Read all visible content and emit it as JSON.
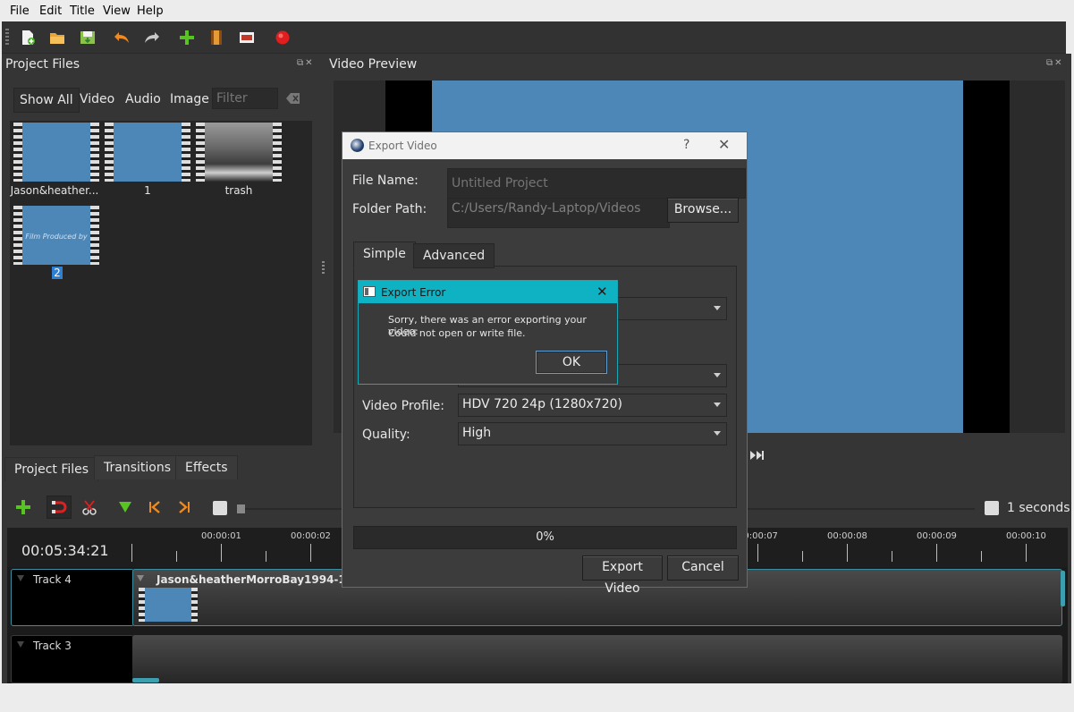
{
  "menu": [
    "File",
    "Edit",
    "Title",
    "View",
    "Help"
  ],
  "project_files": {
    "title": "Project Files",
    "filters": [
      "Show All",
      "Video",
      "Audio",
      "Image"
    ],
    "filter_placeholder": "Filter",
    "items": [
      {
        "label": "Jason&heather..."
      },
      {
        "label": "1"
      },
      {
        "label": "trash"
      },
      {
        "label": "2",
        "overlay": "Film Produced by"
      }
    ]
  },
  "bottom_tabs": [
    "Project Files",
    "Transitions",
    "Effects"
  ],
  "video_preview": {
    "title": "Video Preview"
  },
  "timeline": {
    "timecode": "00:05:34:21",
    "zoom_label": "1 seconds",
    "ticks": [
      "00:00:01",
      "00:00:02",
      "00:00:07",
      "00:00:08",
      "00:00:09",
      "00:00:10"
    ],
    "tracks": [
      {
        "name": "Track 4",
        "clip": "Jason&heatherMorroBay1994-1.m4v"
      },
      {
        "name": "Track 3"
      }
    ]
  },
  "export_dialog": {
    "title": "Export Video",
    "help": "?",
    "file_name_label": "File Name:",
    "file_name_placeholder": "Untitled Project",
    "folder_label": "Folder Path:",
    "folder_value": "C:/Users/Randy-Laptop/Videos",
    "browse": "Browse...",
    "tabs": [
      "Simple",
      "Advanced"
    ],
    "video_profile_label": "Video Profile:",
    "video_profile": "HDV 720 24p (1280x720)",
    "quality_label": "Quality:",
    "quality": "High",
    "progress_text": "0%",
    "progress": 0,
    "export_button": "Export Video",
    "cancel_button": "Cancel"
  },
  "error_dialog": {
    "title": "Export Error",
    "message_line1": "Sorry, there was an error exporting your video:",
    "message_line2": "Could not open or write file.",
    "ok": "OK"
  },
  "colors": {
    "accent": "#0fb2c3",
    "thumb_blue": "#4d87b8",
    "record_red": "#e01e1e"
  }
}
